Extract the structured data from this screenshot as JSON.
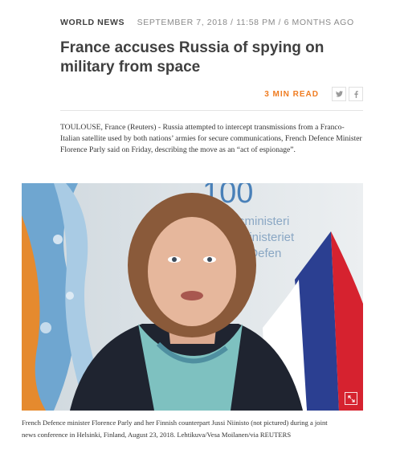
{
  "article": {
    "section": "WORLD NEWS",
    "date": "SEPTEMBER 7, 2018 / 11:58 PM / 6 MONTHS AGO",
    "headline": "France accuses Russia of spying on military from space",
    "read_time": "3 MIN READ",
    "share": {
      "twitter_icon": "twitter-icon",
      "facebook_icon": "facebook-icon"
    },
    "body": "TOULOUSE, France (Reuters) - Russia attempted to intercept transmissions from a Franco-Italian satellite used by both nations’ armies for secure communications, French Defence Minister Florence Parly said on Friday, describing the move as an “act of espionage”.",
    "photo": {
      "backdrop_text": [
        "100",
        "stusministeri",
        "arsministeriet",
        "ry of Defen"
      ],
      "expand_icon": "expand-icon"
    },
    "caption": "French Defence minister Florence Parly and her Finnish counterpart Jussi Niinisto (not pictured) during a joint news conference in Helsinki, Finland, August 23, 2018. Lehtikuva/Vesa Moilanen/via REUTERS"
  },
  "colors": {
    "accent": "#ef7c21",
    "text": "#404040",
    "muted": "#8a8a8a"
  }
}
